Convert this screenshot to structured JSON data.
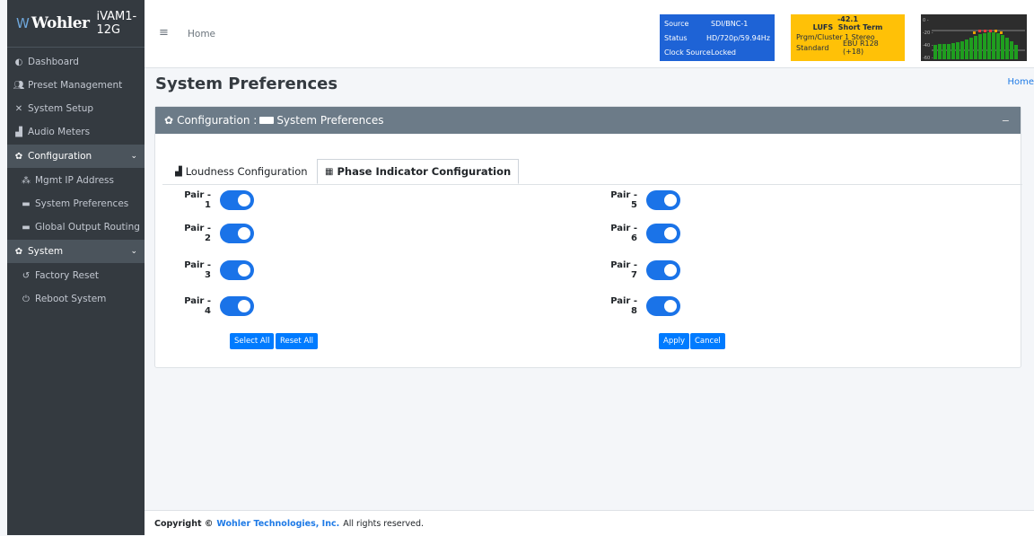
{
  "brand": {
    "logo": "Wohler",
    "model": "iVAM1-12G"
  },
  "sidebar": {
    "items": [
      {
        "label": "Dashboard",
        "icon": "dashboard-icon"
      },
      {
        "label": "Preset Management",
        "icon": "users-icon"
      },
      {
        "label": "System Setup",
        "icon": "tools-icon"
      },
      {
        "label": "Audio Meters",
        "icon": "chart-icon"
      },
      {
        "label": "Configuration",
        "icon": "gear-icon"
      },
      {
        "label": "Mgmt IP Address",
        "icon": "network-icon"
      },
      {
        "label": "System Preferences",
        "icon": "keyboard-icon"
      },
      {
        "label": "Global Output Routing",
        "icon": "keyboard-icon"
      },
      {
        "label": "System",
        "icon": "gears-icon"
      },
      {
        "label": "Factory Reset",
        "icon": "undo-icon"
      },
      {
        "label": "Reboot System",
        "icon": "power-icon"
      }
    ]
  },
  "topbar": {
    "home": "Home",
    "source": {
      "rows": [
        {
          "k": "Source",
          "v": "SDI/BNC-1"
        },
        {
          "k": "Status",
          "v": "HD/720p/59.94Hz"
        },
        {
          "k": "Clock Source",
          "v": "Locked"
        }
      ],
      "color": "#1e63d6"
    },
    "lufs": {
      "value": "-42.1",
      "head_k": "LUFS",
      "head_v": "Short Term",
      "rows": [
        {
          "k": "Prgm/Cluster",
          "v": "1  Stereo"
        },
        {
          "k": "Standard",
          "v": "EBU R128 (+18)"
        }
      ],
      "color": "#ffc107"
    },
    "meter": {
      "scale": [
        "0 -",
        "-20 -",
        "-40 -",
        "-60 -"
      ]
    }
  },
  "page": {
    "title": "System Preferences",
    "breadcrumb": "Home"
  },
  "card": {
    "header_prefix": "Configuration :",
    "header_title": "System Preferences",
    "collapse": "−"
  },
  "tabs": [
    {
      "label": "Loudness Configuration",
      "icon": "chart-icon"
    },
    {
      "label": "Phase Indicator Configuration",
      "icon": "grid-icon"
    }
  ],
  "pairs": {
    "left": [
      "Pair - 1",
      "Pair - 2",
      "Pair - 3",
      "Pair - 4"
    ],
    "right": [
      "Pair - 5",
      "Pair - 6",
      "Pair - 7",
      "Pair - 8"
    ]
  },
  "buttons": {
    "select_all": "Select All",
    "reset_all": "Reset All",
    "apply": "Apply",
    "cancel": "Cancel"
  },
  "footer": {
    "prefix": "Copyright ©",
    "company": "Wohler Technologies, Inc.",
    "suffix": "All rights reserved."
  }
}
